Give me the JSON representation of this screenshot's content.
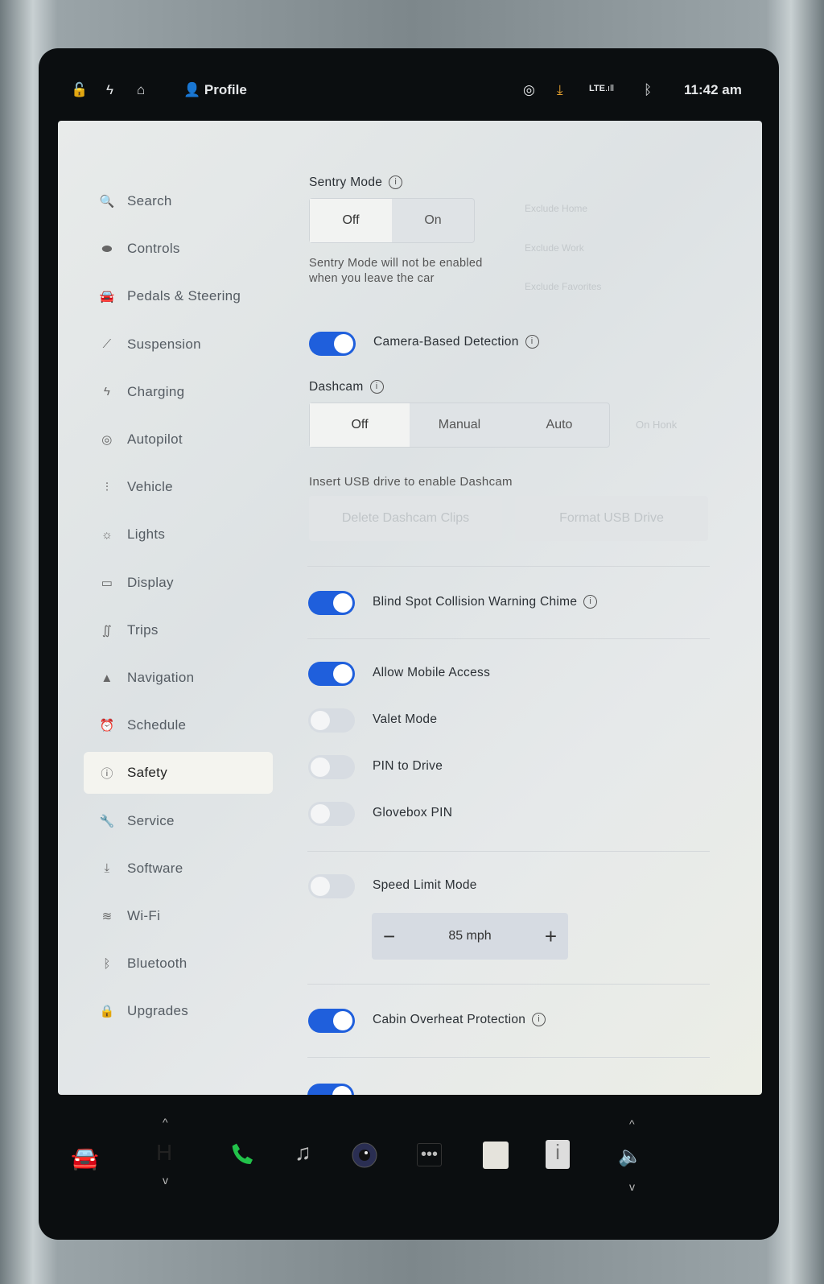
{
  "status": {
    "profile": "Profile",
    "time": "11:42 am",
    "network": "LTE",
    "icons": [
      "lock-icon",
      "bolt-icon",
      "home-icon",
      "person-icon",
      "sentry-icon",
      "download-icon",
      "signal-icon",
      "bluetooth-icon"
    ]
  },
  "sidebar": {
    "items": [
      {
        "label": "Search",
        "icon": "🔍"
      },
      {
        "label": "Controls",
        "icon": "⬬"
      },
      {
        "label": "Pedals & Steering",
        "icon": "🚘"
      },
      {
        "label": "Suspension",
        "icon": "⟋"
      },
      {
        "label": "Charging",
        "icon": "ϟ"
      },
      {
        "label": "Autopilot",
        "icon": "◎"
      },
      {
        "label": "Vehicle",
        "icon": "⫶"
      },
      {
        "label": "Lights",
        "icon": "☼"
      },
      {
        "label": "Display",
        "icon": "▭"
      },
      {
        "label": "Trips",
        "icon": "∬"
      },
      {
        "label": "Navigation",
        "icon": "▲"
      },
      {
        "label": "Schedule",
        "icon": "⏰"
      },
      {
        "label": "Safety",
        "icon": "ⓘ",
        "active": true
      },
      {
        "label": "Service",
        "icon": "🔧"
      },
      {
        "label": "Software",
        "icon": "⤓"
      },
      {
        "label": "Wi-Fi",
        "icon": "≋"
      },
      {
        "label": "Bluetooth",
        "icon": "ᛒ"
      },
      {
        "label": "Upgrades",
        "icon": "🔒"
      }
    ]
  },
  "sentry": {
    "title": "Sentry Mode",
    "options": [
      "Off",
      "On"
    ],
    "selected": "Off",
    "note": "Sentry Mode will not be enabled when you leave the car",
    "exclude": [
      "Exclude Home",
      "Exclude Work",
      "Exclude Favorites"
    ]
  },
  "camera_detection": {
    "label": "Camera-Based Detection",
    "on": true
  },
  "dashcam": {
    "title": "Dashcam",
    "options": [
      "Off",
      "Manual",
      "Auto"
    ],
    "selected": "Off",
    "on_honk": "On Honk",
    "note": "Insert USB drive to enable Dashcam",
    "delete_label": "Delete Dashcam Clips",
    "format_label": "Format USB Drive"
  },
  "toggles": [
    {
      "label": "Blind Spot Collision Warning Chime",
      "on": true,
      "info": true
    },
    {
      "label": "Allow Mobile Access",
      "on": true
    },
    {
      "label": "Valet Mode",
      "on": false
    },
    {
      "label": "PIN to Drive",
      "on": false
    },
    {
      "label": "Glovebox PIN",
      "on": false
    },
    {
      "label": "Speed Limit Mode",
      "on": false
    },
    {
      "label": "Cabin Overheat Protection",
      "on": true,
      "info": true
    }
  ],
  "speed_limit": {
    "value": "85 mph",
    "minus": "−",
    "plus": "+"
  },
  "dock": {
    "icons": [
      "car-icon",
      "climate-icon",
      "phone-icon",
      "music-icon",
      "camera-icon",
      "more-icon",
      "calendar-icon",
      "manual-icon",
      "volume-icon"
    ],
    "phone_color": "#22c24a"
  }
}
